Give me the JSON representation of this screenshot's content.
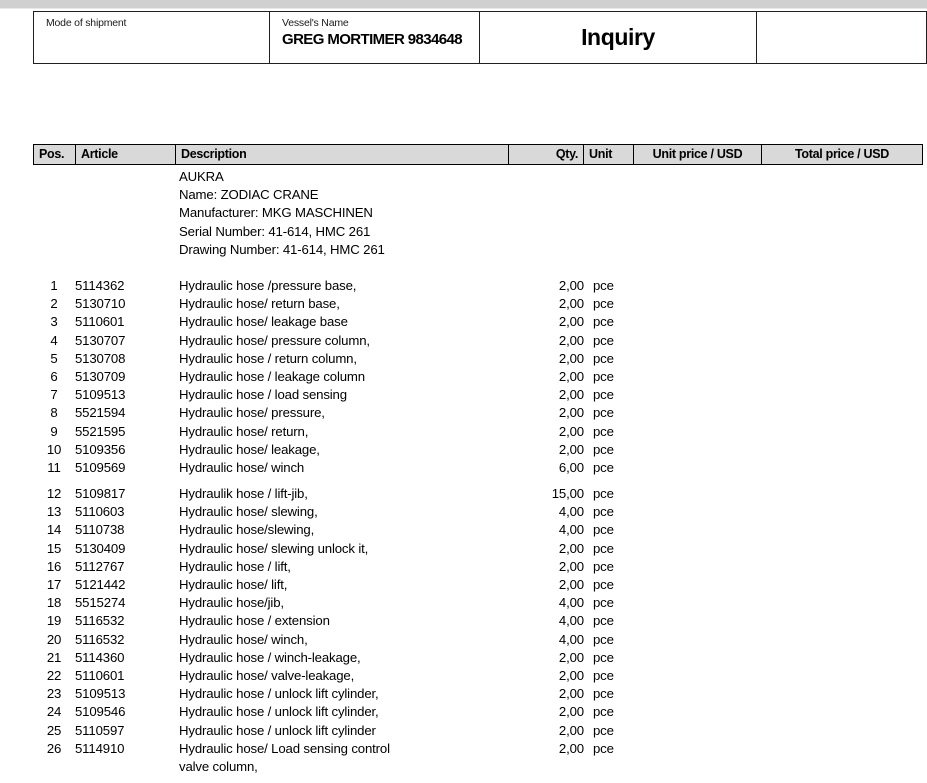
{
  "document": {
    "header": {
      "mode_of_shipment_label": "Mode of shipment",
      "mode_of_shipment_value": "",
      "vessel_name_label": "Vessel's Name",
      "vessel_name_value": "GREG MORTIMER 9834648",
      "title": "Inquiry",
      "extra_cell_value": ""
    },
    "table_headers": {
      "pos": "Pos.",
      "article": "Article",
      "description": "Description",
      "qty": "Qty.",
      "unit": "Unit",
      "unit_price": "Unit price / USD",
      "total_price": "Total price / USD"
    },
    "machine_block": [
      "AUKRA",
      "Name: ZODIAC CRANE",
      "Manufacturer: MKG MASCHINEN",
      "Serial Number: 41-614, HMC 261",
      "Drawing Number: 41-614, HMC 261"
    ],
    "line_items": [
      {
        "pos": "1",
        "article": "5114362",
        "description": "Hydraulic hose /pressure base,",
        "qty": "2,00",
        "unit": "pce",
        "unit_price": "",
        "total_price": ""
      },
      {
        "pos": "2",
        "article": "5130710",
        "description": "Hydraulic hose/ return base,",
        "qty": "2,00",
        "unit": "pce",
        "unit_price": "",
        "total_price": ""
      },
      {
        "pos": "3",
        "article": "5110601",
        "description": "Hydraulic hose/ leakage base",
        "qty": "2,00",
        "unit": "pce",
        "unit_price": "",
        "total_price": ""
      },
      {
        "pos": "4",
        "article": "5130707",
        "description": "Hydraulic hose/ pressure column,",
        "qty": "2,00",
        "unit": "pce",
        "unit_price": "",
        "total_price": ""
      },
      {
        "pos": "5",
        "article": "5130708",
        "description": "Hydraulic hose / return column,",
        "qty": "2,00",
        "unit": "pce",
        "unit_price": "",
        "total_price": ""
      },
      {
        "pos": "6",
        "article": "5130709",
        "description": "Hydraulic hose / leakage column",
        "qty": "2,00",
        "unit": "pce",
        "unit_price": "",
        "total_price": ""
      },
      {
        "pos": "7",
        "article": "5109513",
        "description": "Hydraulic hose / load sensing",
        "qty": "2,00",
        "unit": "pce",
        "unit_price": "",
        "total_price": ""
      },
      {
        "pos": "8",
        "article": "5521594",
        "description": "Hydraulic hose/ pressure,",
        "qty": "2,00",
        "unit": "pce",
        "unit_price": "",
        "total_price": ""
      },
      {
        "pos": "9",
        "article": "5521595",
        "description": "Hydraulic hose/ return,",
        "qty": "2,00",
        "unit": "pce",
        "unit_price": "",
        "total_price": ""
      },
      {
        "pos": "10",
        "article": "5109356",
        "description": "Hydraulic hose/ leakage,",
        "qty": "2,00",
        "unit": "pce",
        "unit_price": "",
        "total_price": ""
      },
      {
        "pos": "11",
        "article": "5109569",
        "description": "Hydraulic hose/ winch",
        "qty": "6,00",
        "unit": "pce",
        "unit_price": "",
        "total_price": "",
        "gap_after": true
      },
      {
        "pos": "12",
        "article": "5109817",
        "description": "Hydraulik hose / lift-jib,",
        "qty": "15,00",
        "unit": "pce",
        "unit_price": "",
        "total_price": ""
      },
      {
        "pos": "13",
        "article": "5110603",
        "description": "Hydraulic hose/ slewing,",
        "qty": "4,00",
        "unit": "pce",
        "unit_price": "",
        "total_price": ""
      },
      {
        "pos": "14",
        "article": "5110738",
        "description": "Hydraulic hose/slewing,",
        "qty": "4,00",
        "unit": "pce",
        "unit_price": "",
        "total_price": ""
      },
      {
        "pos": "15",
        "article": "5130409",
        "description": "Hydraulic hose/ slewing unlock it,",
        "qty": "2,00",
        "unit": "pce",
        "unit_price": "",
        "total_price": ""
      },
      {
        "pos": "16",
        "article": "5112767",
        "description": "Hydraulic hose / lift,",
        "qty": "2,00",
        "unit": "pce",
        "unit_price": "",
        "total_price": ""
      },
      {
        "pos": "17",
        "article": "5121442",
        "description": "Hydraulic hose/ lift,",
        "qty": "2,00",
        "unit": "pce",
        "unit_price": "",
        "total_price": ""
      },
      {
        "pos": "18",
        "article": "5515274",
        "description": "Hydraulic hose/jib,",
        "qty": "4,00",
        "unit": "pce",
        "unit_price": "",
        "total_price": ""
      },
      {
        "pos": "19",
        "article": "5116532",
        "description": "Hydraulic hose / extension",
        "qty": "4,00",
        "unit": "pce",
        "unit_price": "",
        "total_price": ""
      },
      {
        "pos": "20",
        "article": "5116532",
        "description": "Hydraulic hose/ winch,",
        "qty": "4,00",
        "unit": "pce",
        "unit_price": "",
        "total_price": ""
      },
      {
        "pos": "21",
        "article": "5114360",
        "description": "Hydraulic hose / winch-leakage,",
        "qty": "2,00",
        "unit": "pce",
        "unit_price": "",
        "total_price": ""
      },
      {
        "pos": "22",
        "article": "5110601",
        "description": "Hydraulic hose/ valve-leakage,",
        "qty": "2,00",
        "unit": "pce",
        "unit_price": "",
        "total_price": ""
      },
      {
        "pos": "23",
        "article": "5109513",
        "description": "Hydraulic hose / unlock lift cylinder,",
        "qty": "2,00",
        "unit": "pce",
        "unit_price": "",
        "total_price": ""
      },
      {
        "pos": "24",
        "article": "5109546",
        "description": "Hydraulic hose / unlock lift cylinder,",
        "qty": "2,00",
        "unit": "pce",
        "unit_price": "",
        "total_price": ""
      },
      {
        "pos": "25",
        "article": "5110597",
        "description": "Hydraulic hose / unlock lift cylinder",
        "qty": "2,00",
        "unit": "pce",
        "unit_price": "",
        "total_price": ""
      },
      {
        "pos": "26",
        "article": "5114910",
        "description": "Hydraulic hose/ Load sensing control",
        "description_line2": "valve column,",
        "qty": "2,00",
        "unit": "pce",
        "unit_price": "",
        "total_price": ""
      }
    ]
  }
}
